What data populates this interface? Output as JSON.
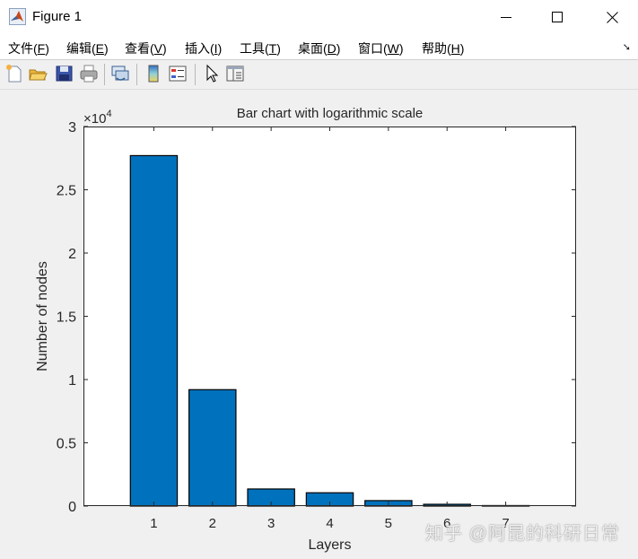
{
  "window": {
    "title": "Figure 1",
    "minimize_icon": "minimize-icon",
    "maximize_icon": "maximize-icon",
    "close_icon": "close-icon"
  },
  "menu": {
    "items": [
      {
        "label": "文件",
        "key": "F"
      },
      {
        "label": "编辑",
        "key": "E"
      },
      {
        "label": "查看",
        "key": "V"
      },
      {
        "label": "插入",
        "key": "I"
      },
      {
        "label": "工具",
        "key": "T"
      },
      {
        "label": "桌面",
        "key": "D"
      },
      {
        "label": "窗口",
        "key": "W"
      },
      {
        "label": "帮助",
        "key": "H"
      }
    ],
    "dock_icon": "dock-arrow-icon"
  },
  "toolbar": {
    "buttons": [
      "new-figure-icon",
      "open-file-icon",
      "save-icon",
      "print-icon",
      "link-plot-icon",
      "colorbar-icon",
      "legend-icon",
      "pointer-icon",
      "property-editor-icon"
    ]
  },
  "watermark": "知乎 @阿昆的科研日常",
  "colors": {
    "bar_fill": "#0072bd",
    "bar_edge": "#000000",
    "axes_bg": "#ffffff",
    "figure_bg": "#f0f0f0"
  },
  "chart_data": {
    "type": "bar",
    "title": "Bar chart with logarithmic scale",
    "xlabel": "Layers",
    "ylabel": "Number of nodes",
    "categories": [
      "1",
      "2",
      "3",
      "4",
      "5",
      "6",
      "7"
    ],
    "x": [
      1,
      2,
      3,
      4,
      5,
      6,
      7
    ],
    "values": [
      27700,
      9200,
      1350,
      1050,
      430,
      140,
      40
    ],
    "xlim": [
      -0.2,
      8.2
    ],
    "ylim": [
      0,
      30000
    ],
    "yticks": [
      0,
      5000,
      10000,
      15000,
      20000,
      25000,
      30000
    ],
    "ytick_labels": [
      "0",
      "0.5",
      "1",
      "1.5",
      "2",
      "2.5",
      "3"
    ],
    "exponent_label": "×10",
    "exponent_power": "4",
    "grid": false,
    "legend": null
  }
}
